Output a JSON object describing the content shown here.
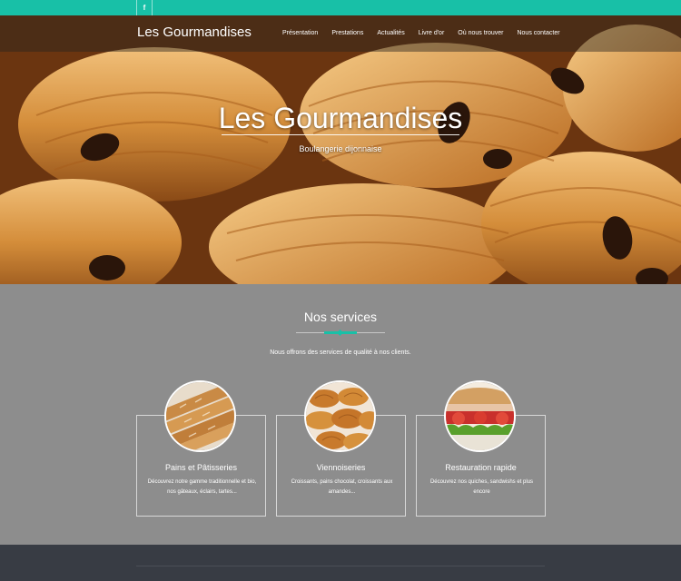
{
  "topbar": {
    "social_icon": "facebook-icon",
    "social_glyph": "f",
    "accent_color": "#18c0a7"
  },
  "navbar": {
    "brand": "Les Gourmandises",
    "items": [
      "Présentation",
      "Prestations",
      "Actualités",
      "Livre d'or",
      "Où nous trouver",
      "Nous contacter"
    ]
  },
  "hero": {
    "title": "Les Gourmandises",
    "subtitle": "Boulangerie dijonnaise"
  },
  "services": {
    "title": "Nos services",
    "intro": "Nous offrons des services de qualité à nos clients.",
    "cards": [
      {
        "title": "Pains et Pâtisseries",
        "description": "Découvrez notre gamme traditionnelle et bio, nos gâteaux, éclairs, tartes..."
      },
      {
        "title": "Viennoiseries",
        "description": "Croissants, pains chocolat, croissants aux amandes..."
      },
      {
        "title": "Restauration rapide",
        "description": "Découvrez nos quiches, sandwishs et plus encore"
      }
    ]
  },
  "colors": {
    "accent": "#18c0a7",
    "section_bg": "#8d8d8d",
    "footer_bg": "#383c44"
  }
}
